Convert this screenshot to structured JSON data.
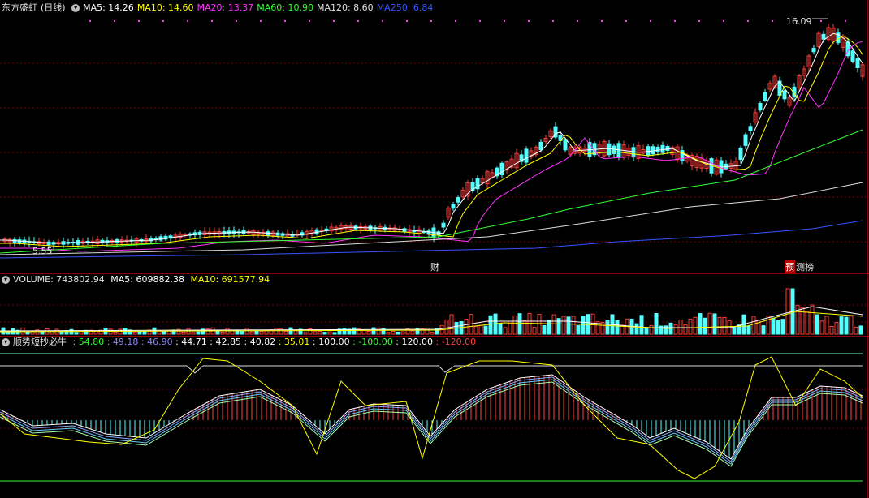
{
  "stock": {
    "name": "东方盛虹",
    "period": "(日线)",
    "ma": [
      {
        "label": "MA5: 14.26",
        "color": "#ffffff"
      },
      {
        "label": "MA10: 14.60",
        "color": "#ffff00"
      },
      {
        "label": "MA20: 13.37",
        "color": "#ff33ff"
      },
      {
        "label": "MA60: 10.90",
        "color": "#33ff33"
      },
      {
        "label": "MA120: 8.60",
        "color": "#e0e0e0"
      },
      {
        "label": "MA250: 6.84",
        "color": "#3355ff"
      }
    ],
    "high_label": "16.09",
    "low_label": "5.55",
    "marker_cai": "财",
    "marker_yu": "预",
    "marker_bang": "测榜"
  },
  "volume": {
    "label": "VOLUME: 743802.94",
    "ma5": "MA5: 609882.38",
    "ma10": "MA10: 691577.94"
  },
  "indicator": {
    "name": "顺势短抄必牛",
    "values": [
      {
        "text": "54.80",
        "color": "#33ff33"
      },
      {
        "text": "49.18",
        "color": "#8888ff"
      },
      {
        "text": "46.90",
        "color": "#8888ff"
      },
      {
        "text": "44.71",
        "color": "#ffffff"
      },
      {
        "text": "42.85",
        "color": "#ffffff"
      },
      {
        "text": "40.82",
        "color": "#ffffff"
      },
      {
        "text": "35.01",
        "color": "#ffff00"
      },
      {
        "text": "100.00",
        "color": "#ffffff"
      },
      {
        "text": "-100.00",
        "color": "#33ff33"
      },
      {
        "text": "120.00",
        "color": "#ffffff"
      },
      {
        "text": "-120.00",
        "color": "#ff4444"
      }
    ]
  }
}
